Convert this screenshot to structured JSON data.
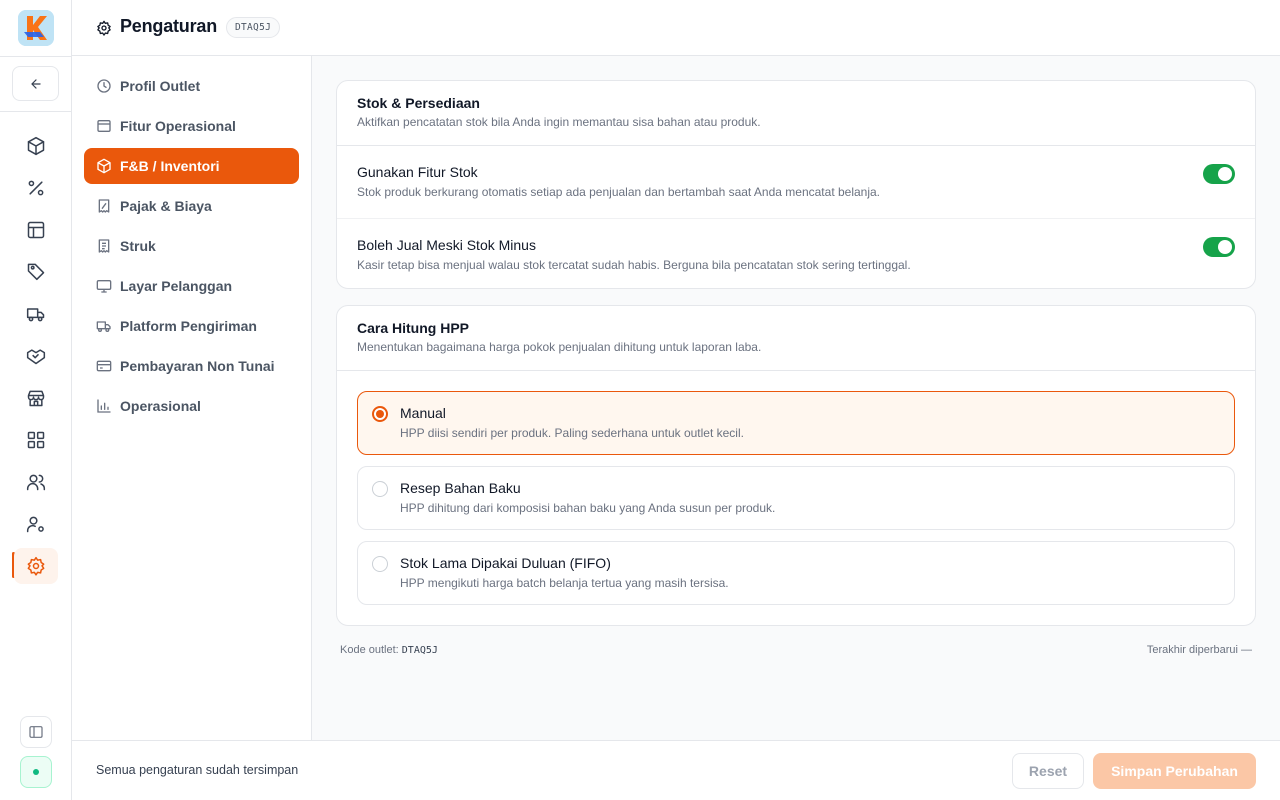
{
  "app": {
    "logo_icon": "kasir-logo",
    "accent_color": "#ea580c",
    "success_color": "#16a34a"
  },
  "rail": {
    "back_icon": "arrow-left-icon",
    "items": [
      {
        "icon": "package-icon",
        "active": false
      },
      {
        "icon": "percent-icon",
        "active": false
      },
      {
        "icon": "layout-icon",
        "active": false
      },
      {
        "icon": "tag-icon",
        "active": false
      },
      {
        "icon": "truck-icon",
        "active": false
      },
      {
        "icon": "handshake-icon",
        "active": false
      },
      {
        "icon": "store-icon",
        "active": false
      },
      {
        "icon": "grid-icon",
        "active": false
      },
      {
        "icon": "users-icon",
        "active": false
      },
      {
        "icon": "user-cog-icon",
        "active": false
      },
      {
        "icon": "gear-icon",
        "active": true
      }
    ],
    "collapse_icon": "sidebar-icon",
    "status_indicator": "online-dot"
  },
  "header": {
    "title": "Pengaturan",
    "outlet_code": "DTAQ5J"
  },
  "settings_nav": {
    "items": [
      {
        "label": "Profil Outlet",
        "icon": "clock-icon",
        "active": false
      },
      {
        "label": "Fitur Operasional",
        "icon": "archive-icon",
        "active": false
      },
      {
        "label": "F&B / Inventori",
        "icon": "package-icon",
        "active": true
      },
      {
        "label": "Pajak & Biaya",
        "icon": "receipt-percent-icon",
        "active": false
      },
      {
        "label": "Struk",
        "icon": "receipt-icon",
        "active": false
      },
      {
        "label": "Layar Pelanggan",
        "icon": "monitor-icon",
        "active": false
      },
      {
        "label": "Platform Pengiriman",
        "icon": "truck-icon",
        "active": false
      },
      {
        "label": "Pembayaran Non Tunai",
        "icon": "credit-card-icon",
        "active": false
      },
      {
        "label": "Operasional",
        "icon": "bar-chart-icon",
        "active": false
      }
    ]
  },
  "stock_card": {
    "title": "Stok & Persediaan",
    "description": "Aktifkan pencatatan stok bila Anda ingin memantau sisa bahan atau produk.",
    "rows": [
      {
        "title": "Gunakan Fitur Stok",
        "description": "Stok produk berkurang otomatis setiap ada penjualan dan bertambah saat Anda mencatat belanja.",
        "enabled": true
      },
      {
        "title": "Boleh Jual Meski Stok Minus",
        "description": "Kasir tetap bisa menjual walau stok tercatat sudah habis. Berguna bila pencatatan stok sering tertinggal.",
        "enabled": true
      }
    ]
  },
  "hpp_card": {
    "title": "Cara Hitung HPP",
    "description": "Menentukan bagaimana harga pokok penjualan dihitung untuk laporan laba.",
    "options": [
      {
        "title": "Manual",
        "description": "HPP diisi sendiri per produk. Paling sederhana untuk outlet kecil.",
        "selected": true
      },
      {
        "title": "Resep Bahan Baku",
        "description": "HPP dihitung dari komposisi bahan baku yang Anda susun per produk.",
        "selected": false
      },
      {
        "title": "Stok Lama Dipakai Duluan (FIFO)",
        "description": "HPP mengikuti harga batch belanja tertua yang masih tersisa.",
        "selected": false
      }
    ]
  },
  "meta": {
    "outlet_code_label": "Kode outlet:",
    "outlet_code": "DTAQ5J",
    "last_updated": "Terakhir diperbarui —"
  },
  "footer": {
    "status": "Semua pengaturan sudah tersimpan",
    "reset_label": "Reset",
    "save_label": "Simpan Perubahan"
  }
}
